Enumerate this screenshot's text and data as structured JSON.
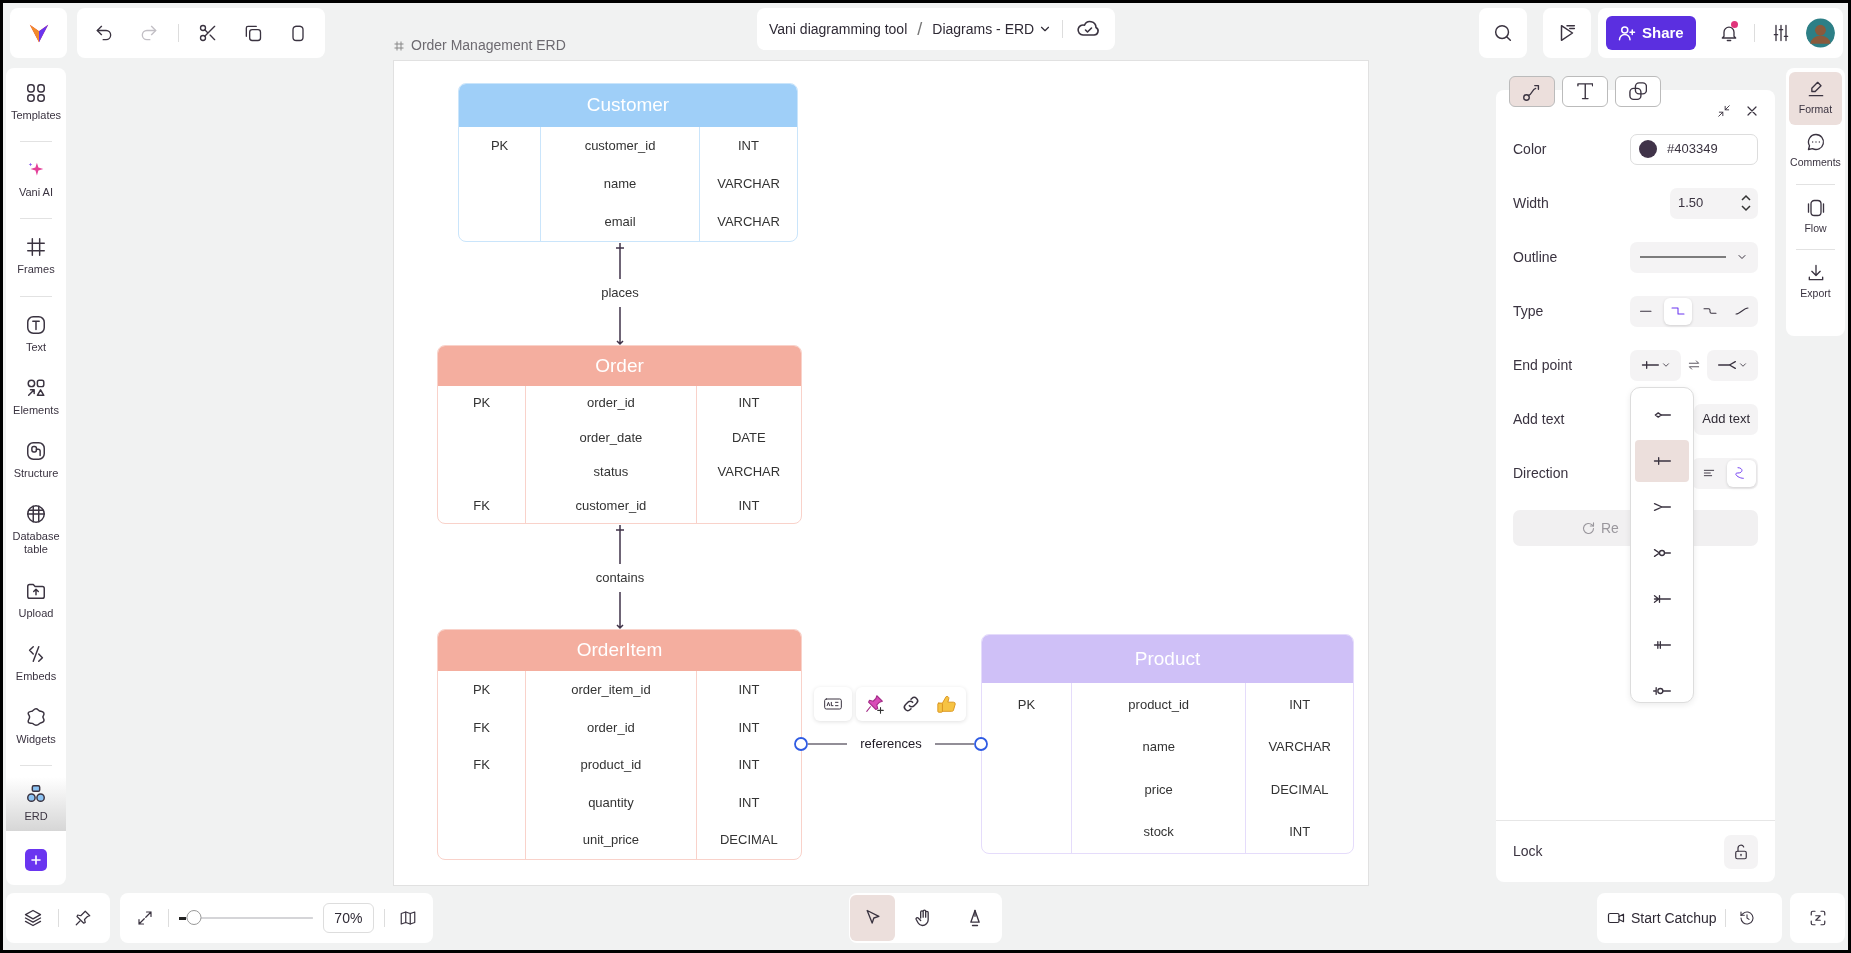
{
  "toolbar": [
    {
      "kind": "undo",
      "disabled": false
    },
    {
      "kind": "redo",
      "disabled": true
    },
    {
      "kind": "cut",
      "disabled": false
    },
    {
      "kind": "copy",
      "disabled": false
    },
    {
      "kind": "paste",
      "disabled": false
    }
  ],
  "sidebar": {
    "groups": [
      {
        "items": [
          {
            "kind": "templates",
            "label": "Templates",
            "selected": false
          }
        ]
      },
      {
        "items": [
          {
            "kind": "ai",
            "label": "Vani AI",
            "selected": false
          }
        ]
      },
      {
        "items": [
          {
            "kind": "frames",
            "label": "Frames",
            "selected": false
          }
        ]
      },
      {
        "items": [
          {
            "kind": "text",
            "label": "Text",
            "selected": false
          },
          {
            "kind": "elements",
            "label": "Elements",
            "selected": false
          },
          {
            "kind": "structure",
            "label": "Structure",
            "selected": false
          },
          {
            "kind": "database",
            "label": "Database table",
            "selected": false
          },
          {
            "kind": "upload",
            "label": "Upload",
            "selected": false
          },
          {
            "kind": "embeds",
            "label": "Embeds",
            "selected": false
          },
          {
            "kind": "widgets",
            "label": "Widgets",
            "selected": false
          }
        ]
      },
      {
        "items": [
          {
            "kind": "erd",
            "label": "ERD",
            "selected": true
          }
        ]
      }
    ]
  },
  "breadcrumb": {
    "project": "Vani diagramming tool",
    "separator": "/",
    "page": "Diagrams - ERD"
  },
  "header": {
    "share": "Share",
    "unread_notifications": true
  },
  "frame": {
    "title": "Order Management ERD"
  },
  "tables": [
    {
      "title": "Customer",
      "color": "#9fcff8",
      "rows": [
        {
          "key": "PK",
          "name": "customer_id",
          "type": "INT"
        },
        {
          "key": "",
          "name": "name",
          "type": "VARCHAR"
        },
        {
          "key": "",
          "name": "email",
          "type": "VARCHAR"
        }
      ]
    },
    {
      "title": "Order",
      "color": "#f4ae9f",
      "rows": [
        {
          "key": "PK",
          "name": "order_id",
          "type": "INT"
        },
        {
          "key": "",
          "name": "order_date",
          "type": "DATE"
        },
        {
          "key": "",
          "name": "status",
          "type": "VARCHAR"
        },
        {
          "key": "FK",
          "name": "customer_id",
          "type": "INT"
        }
      ]
    },
    {
      "title": "OrderItem",
      "color": "#f4ae9f",
      "rows": [
        {
          "key": "PK",
          "name": "order_item_id",
          "type": "INT"
        },
        {
          "key": "FK",
          "name": "order_id",
          "type": "INT"
        },
        {
          "key": "FK",
          "name": "product_id",
          "type": "INT"
        },
        {
          "key": "",
          "name": "quantity",
          "type": "INT"
        },
        {
          "key": "",
          "name": "unit_price",
          "type": "DECIMAL"
        }
      ]
    },
    {
      "title": "Product",
      "color": "#cfc0f7",
      "rows": [
        {
          "key": "PK",
          "name": "product_id",
          "type": "INT"
        },
        {
          "key": "",
          "name": "name",
          "type": "VARCHAR"
        },
        {
          "key": "",
          "name": "price",
          "type": "DECIMAL"
        },
        {
          "key": "",
          "name": "stock",
          "type": "INT"
        }
      ]
    }
  ],
  "relations": [
    {
      "label": "places",
      "selected": false
    },
    {
      "label": "contains",
      "selected": false
    },
    {
      "label": "references",
      "selected": true
    }
  ],
  "format_panel": {
    "tabs": [
      {
        "kind": "connector",
        "selected": true
      },
      {
        "kind": "text",
        "selected": false
      },
      {
        "kind": "layers",
        "selected": false
      }
    ],
    "color": {
      "label": "Color",
      "value": "#403349",
      "color": "#403349"
    },
    "width": {
      "label": "Width",
      "value": "1.50"
    },
    "outline": {
      "label": "Outline"
    },
    "type": {
      "label": "Type",
      "options": [
        {
          "kind": "straight",
          "selected": false
        },
        {
          "kind": "elbow",
          "selected": true
        },
        {
          "kind": "rounded",
          "selected": false
        },
        {
          "kind": "curve",
          "selected": false
        }
      ]
    },
    "end_point": {
      "label": "End point"
    },
    "add_text": {
      "label": "Add text",
      "button": "Add text"
    },
    "direction": {
      "label": "Direction",
      "options": [
        {
          "selected": false
        },
        {
          "selected": true
        }
      ]
    },
    "reset": "Re",
    "lock": {
      "label": "Lock",
      "locked": false
    }
  },
  "endpoint_menu": [
    {
      "kind": "diamond",
      "selected": false
    },
    {
      "kind": "one",
      "selected": true
    },
    {
      "kind": "many",
      "selected": false
    },
    {
      "kind": "zero-many",
      "selected": false
    },
    {
      "kind": "one-many",
      "selected": false
    },
    {
      "kind": "one-only",
      "selected": false
    },
    {
      "kind": "zero-one",
      "selected": false
    }
  ],
  "side_tabs": [
    {
      "kind": "format",
      "label": "Format",
      "selected": true
    },
    {
      "kind": "comments",
      "label": "Comments",
      "selected": false
    },
    {
      "kind": "flow",
      "label": "Flow",
      "selected": false
    },
    {
      "kind": "export",
      "label": "Export",
      "selected": false
    }
  ],
  "bottom": {
    "zoom": {
      "level": 0.1,
      "value": "70%"
    },
    "tools": [
      {
        "kind": "select",
        "selected": true
      },
      {
        "kind": "hand",
        "selected": false
      },
      {
        "kind": "pen",
        "selected": false
      }
    ],
    "catchup": "Start Catchup"
  }
}
